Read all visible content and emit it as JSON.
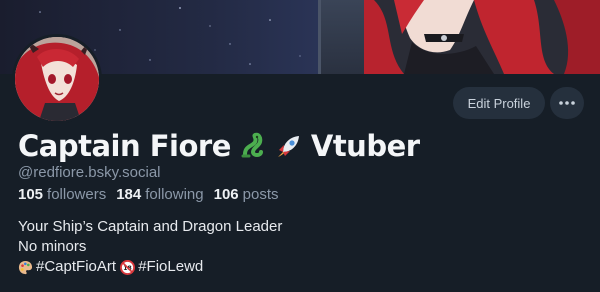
{
  "profile": {
    "display_name_text": "Captain Fiore",
    "display_name_suffix": "Vtuber",
    "handle": "@redfiore.bsky.social",
    "stats": {
      "followers_count": "105",
      "followers_label": "followers",
      "following_count": "184",
      "following_label": "following",
      "posts_count": "106",
      "posts_label": "posts"
    },
    "bio": {
      "line1": "Your Ship’s Captain and Dragon Leader",
      "line2": "No minors",
      "tag1": "#CaptFioArt",
      "tag2": "#FioLewd"
    }
  },
  "actions": {
    "edit_profile_label": "Edit Profile"
  },
  "icons": {
    "name_emoji_1": "dragon-icon",
    "name_emoji_2": "rocket-icon",
    "tag1_icon": "artist-palette-icon",
    "tag2_icon": "no-one-under-eighteen-icon",
    "more": "ellipsis-icon"
  },
  "colors": {
    "background": "#161e27",
    "button_bg": "#25303d",
    "muted_text": "#8b98a8"
  }
}
